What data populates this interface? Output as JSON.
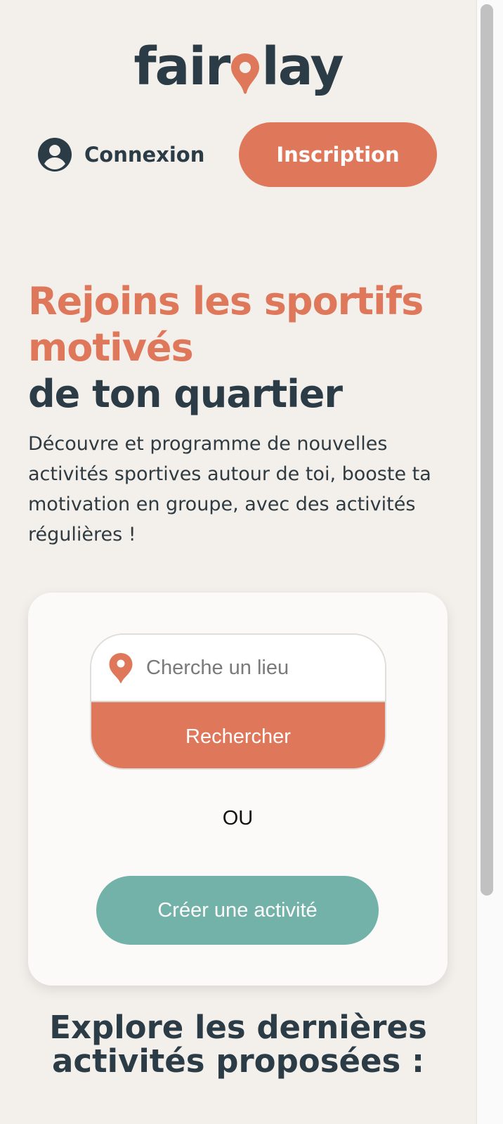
{
  "brand": {
    "logo_part1": "fair",
    "logo_part2": "lay",
    "colors": {
      "primary": "#df785b",
      "dark": "#2c3c46",
      "teal": "#72b2a9",
      "background": "#f3f0ec"
    }
  },
  "header": {
    "login_label": "Connexion",
    "login_icon": "user-circle-icon",
    "signup_label": "Inscription"
  },
  "hero": {
    "title_accent": "Rejoins les sportifs motivés",
    "title_dark": "de ton quartier",
    "description": "Découvre et programme de nouvelles activités sportives autour de toi, booste ta motivation en groupe, avec des activités régulières !"
  },
  "search": {
    "placeholder": "Cherche un lieu",
    "location_icon": "map-pin-icon",
    "button_label": "Rechercher",
    "or_label": "OU",
    "create_label": "Créer une activité"
  },
  "explore": {
    "title": "Explore les dernières activités proposées :"
  }
}
